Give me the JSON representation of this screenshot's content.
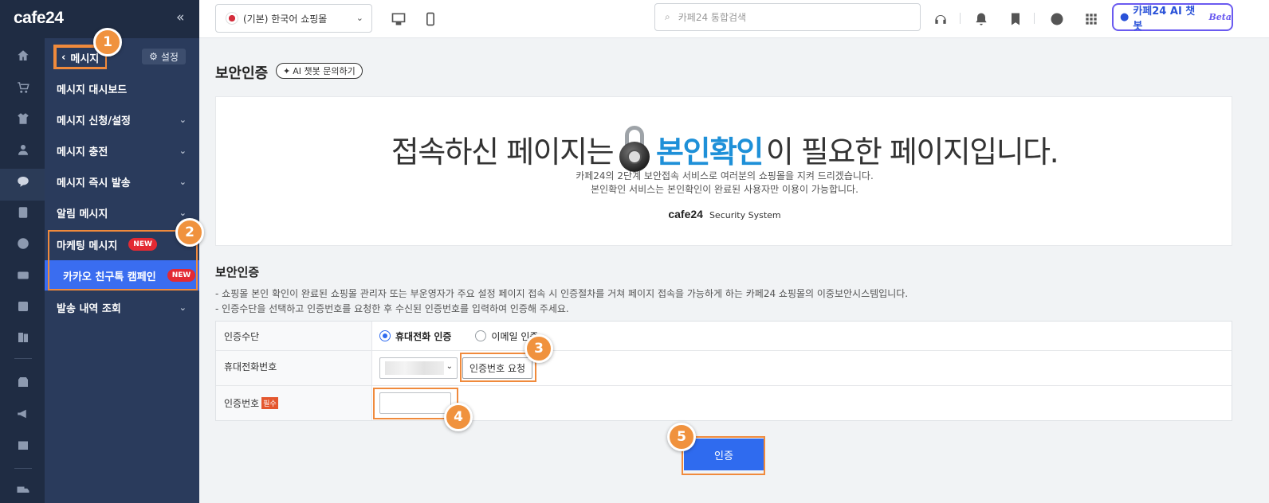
{
  "app": {
    "logo": "cafe24",
    "collapse_icon": "double-chevron-left-icon"
  },
  "panel": {
    "title": "메시지",
    "settings_label": "설정",
    "items": [
      {
        "label": "메시지 대시보드"
      },
      {
        "label": "메시지 신청/설정"
      },
      {
        "label": "메시지 충전"
      },
      {
        "label": "메시지 즉시 발송"
      },
      {
        "label": "알림 메시지"
      },
      {
        "label": "마케팅 메시지",
        "badge": "NEW"
      },
      {
        "label": "카카오 친구톡 캠페인",
        "badge": "NEW"
      },
      {
        "label": "발송 내역 조회"
      }
    ]
  },
  "topbar": {
    "shop_select": "(기본) 한국어 쇼핑몰",
    "search_placeholder": "카페24 통합검색",
    "ai_button": "카페24 AI 챗봇",
    "ai_beta": "Beta"
  },
  "page": {
    "title": "보안인증",
    "ai_chip": "AI 챗봇 문의하기",
    "banner": {
      "headline_before": "접속하신 페이지는",
      "headline_highlight": "본인확인",
      "headline_after": "이 필요한 페이지입니다.",
      "sub1": "카페24의 2단계 보안접속 서비스로 여러분의 쇼핑몰을 지켜 드리겠습니다.",
      "sub2": "본인확인 서비스는 본인확인이 완료된 사용자만 이용이 가능합니다.",
      "brand": "cafe24",
      "system": "Security System"
    },
    "section_title": "보안인증",
    "desc1": "쇼핑몰 본인 확인이 완료된 쇼핑몰 관리자 또는 부운영자가 주요 설정 페이지 접속 시 인증절차를 거쳐 페이지 접속을 가능하게 하는 카페24 쇼핑몰의 이중보안시스템입니다.",
    "desc2": "인증수단을 선택하고 인증번호를 요청한 후 수신된 인증번호를 입력하여 인증해 주세요.",
    "form": {
      "method_label": "인증수단",
      "method_phone": "휴대전화 인증",
      "method_email": "이메일 인증",
      "selected_method": "휴대전화 인증",
      "phone_label": "휴대전화번호",
      "request_button": "인증번호 요청",
      "code_label": "인증번호",
      "required_tag": "필수",
      "code_value": ""
    },
    "submit_label": "인증"
  },
  "badges": [
    "1",
    "2",
    "3",
    "4",
    "5"
  ],
  "colors": {
    "accent": "#f08a3c",
    "primary": "#2f6bef",
    "sidebar": "#1f2c43",
    "panel": "#2a3b5c"
  }
}
